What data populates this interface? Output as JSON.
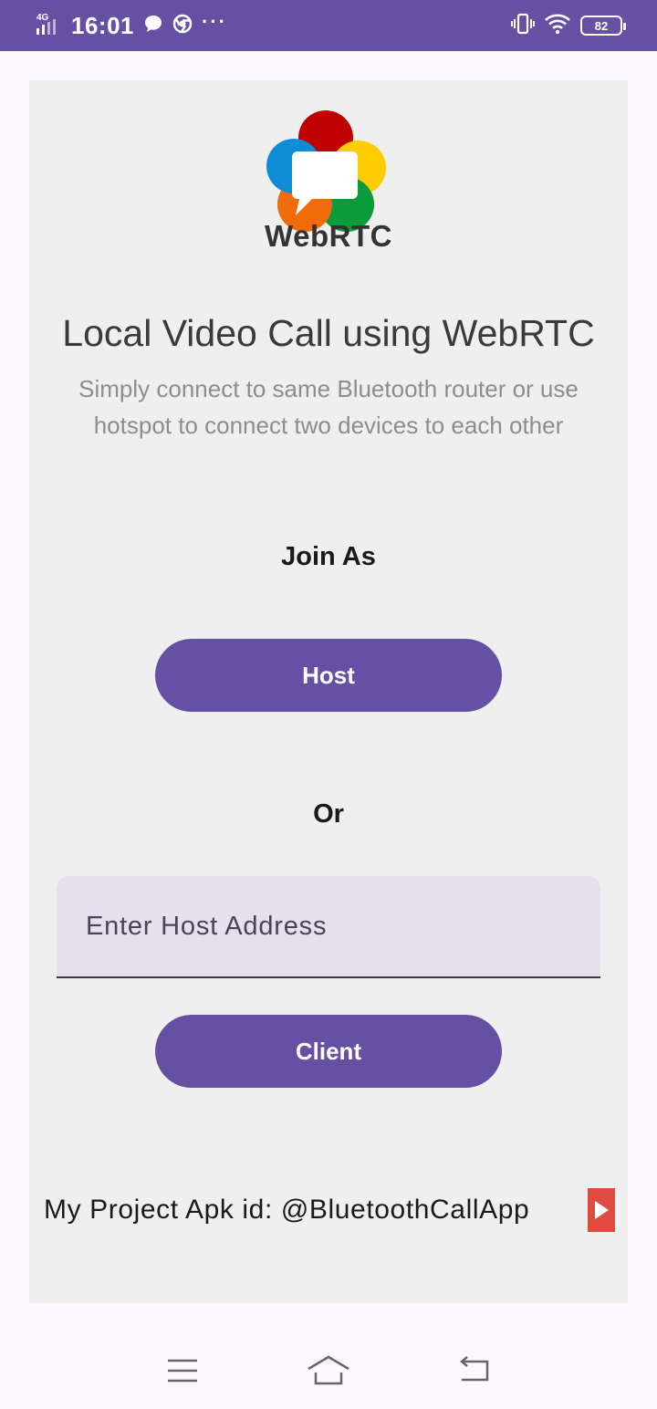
{
  "status_bar": {
    "network": "4G",
    "time": "16:01",
    "more": "···",
    "battery": "82"
  },
  "logo": {
    "text": "WebRTC"
  },
  "main": {
    "title": "Local Video Call using WebRTC",
    "subtitle": "Simply connect to same Bluetooth router or use hotspot to connect two devices to each other",
    "join_as": "Join As",
    "host_button": "Host",
    "or_label": "Or",
    "host_address_placeholder": "Enter Host Address",
    "host_address_value": "",
    "client_button": "Client",
    "footer_text": "My Project Apk id: @BluetoothCallApp"
  },
  "colors": {
    "accent": "#6650a4",
    "card_bg": "#efefef",
    "input_bg": "#e6e0ec",
    "ad_icon": "#e04a3f"
  },
  "icons": [
    "signal-icon",
    "chat-bubble-icon",
    "chrome-icon",
    "vibrate-icon",
    "wifi-icon",
    "battery-icon",
    "play-icon",
    "menu-icon",
    "home-icon",
    "back-icon"
  ]
}
